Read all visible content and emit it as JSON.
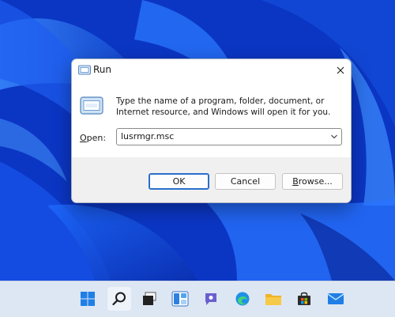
{
  "window": {
    "title": "Run",
    "description": "Type the name of a program, folder, document, or Internet resource, and Windows will open it for you.",
    "open_label_underlined": "O",
    "open_label_rest": "pen:",
    "open_value": "lusrmgr.msc"
  },
  "buttons": {
    "ok": "OK",
    "cancel": "Cancel",
    "browse_underlined": "B",
    "browse_rest": "rowse..."
  },
  "taskbar": {
    "items": [
      "start",
      "search",
      "task-view",
      "widgets",
      "teams-chat",
      "edge",
      "file-explorer",
      "microsoft-store",
      "mail"
    ]
  },
  "colors": {
    "wallpaper": "#0f3fcf",
    "accent": "#2a6ecb",
    "taskbar": "#dde6f3"
  }
}
